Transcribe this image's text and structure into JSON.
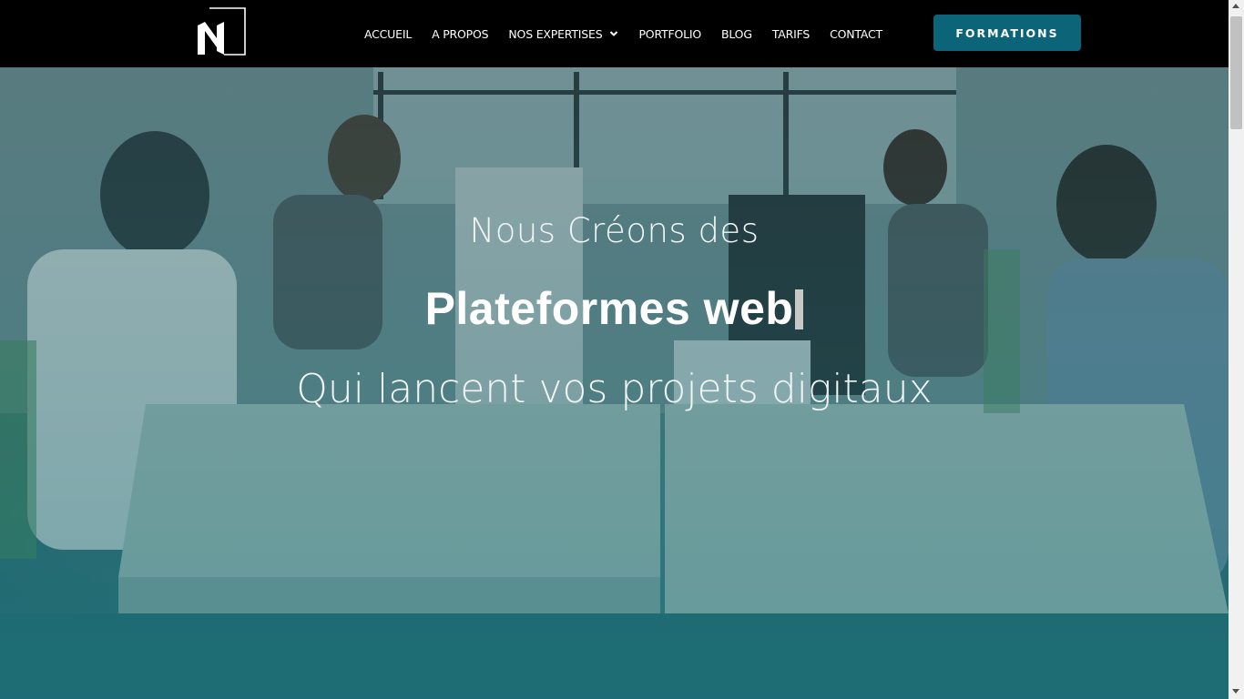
{
  "nav": {
    "logo_alt": "N",
    "items": [
      {
        "label": "ACCUEIL"
      },
      {
        "label": "A PROPOS"
      },
      {
        "label": "NOS EXPERTISES",
        "has_dropdown": true
      },
      {
        "label": "PORTFOLIO"
      },
      {
        "label": "BLOG"
      },
      {
        "label": "TARIFS"
      },
      {
        "label": "CONTACT"
      }
    ],
    "cta_label": "FORMATIONS"
  },
  "hero": {
    "line1": "Nous Créons des",
    "line2": "Plateformes web",
    "line3": "Qui lancent vos projets digitaux",
    "background": "office-team-photo"
  },
  "colors": {
    "nav_bg": "#000000",
    "accent": "#0b6478",
    "overlay": "#126e78"
  }
}
